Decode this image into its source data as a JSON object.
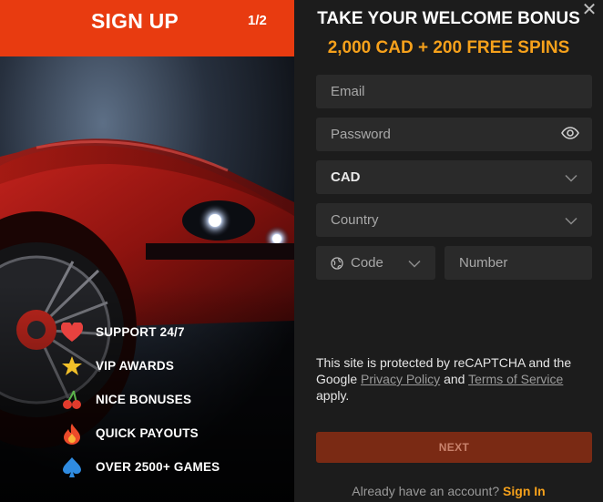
{
  "left": {
    "title": "SIGN UP",
    "step": "1/2",
    "features": [
      {
        "label": "SUPPORT 24/7",
        "icon": "heart-icon",
        "color": "#e8423f"
      },
      {
        "label": "VIP AWARDS",
        "icon": "star-icon",
        "color": "#f2c029"
      },
      {
        "label": "NICE BONUSES",
        "icon": "cherries-icon",
        "color": "#e23b2d"
      },
      {
        "label": "QUICK PAYOUTS",
        "icon": "flame-icon",
        "color": "#ec4a2a"
      },
      {
        "label": "OVER 2500+ GAMES",
        "icon": "spade-icon",
        "color": "#2f8be0"
      }
    ]
  },
  "right": {
    "title": "TAKE YOUR WELCOME BONUS",
    "bonus": "2,000 CAD + 200 FREE SPINS",
    "email_placeholder": "Email",
    "password_placeholder": "Password",
    "currency_value": "CAD",
    "country_placeholder": "Country",
    "code_placeholder": "Code",
    "number_placeholder": "Number",
    "recaptcha": {
      "text_1": "This site is protected by reCAPTCHA and the Google ",
      "privacy": "Privacy Policy",
      "and": " and ",
      "terms": "Terms of Service",
      "text_2": " apply."
    },
    "next_label": "NEXT",
    "signin_prompt": "Already have an account?",
    "signin_link": "Sign In"
  },
  "colors": {
    "header_bg": "#e83b10",
    "accent_orange": "#f6a11b",
    "next_bg": "#7a2a14",
    "field_bg": "#2a2a2a",
    "panel_bg": "#1c1c1c"
  }
}
